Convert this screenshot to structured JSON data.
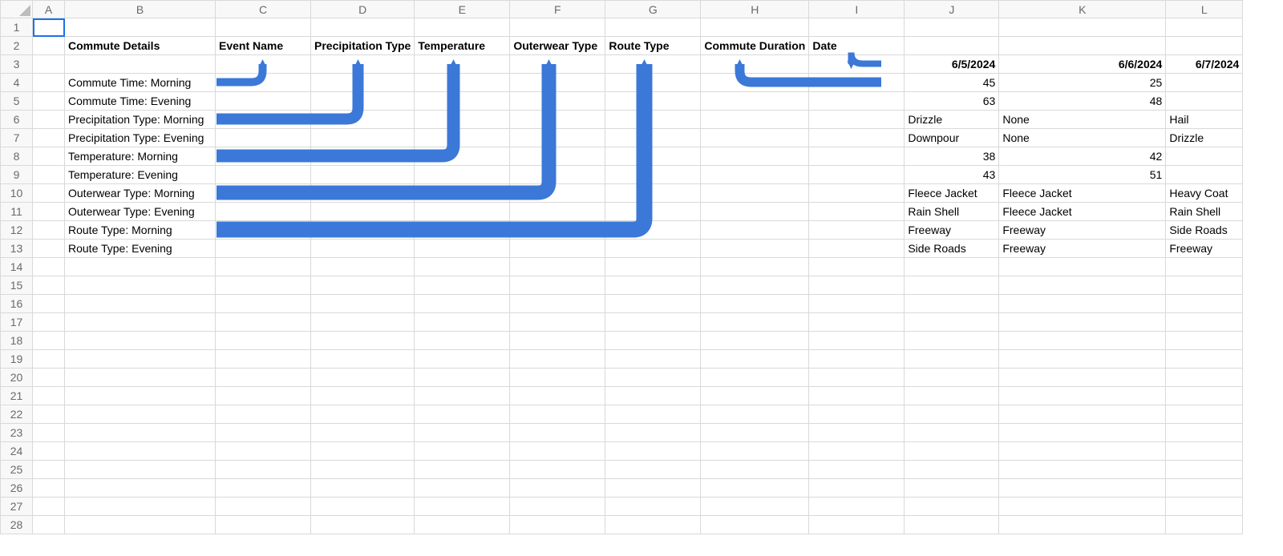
{
  "columns": [
    "A",
    "B",
    "C",
    "D",
    "E",
    "F",
    "G",
    "H",
    "I",
    "J",
    "K",
    "L"
  ],
  "row_count": 28,
  "selected_cell": "A1",
  "header_row": {
    "B": "Commute Details",
    "C": "Event Name",
    "D": "Precipitation Type",
    "E": "Temperature",
    "F": "Outerwear Type",
    "G": "Route Type",
    "H": "Commute Duration",
    "I": "Date"
  },
  "date_row": {
    "J": "6/5/2024",
    "K": "6/6/2024",
    "L": "6/7/2024"
  },
  "rows": [
    {
      "label": "Commute Time: Morning",
      "J": "45",
      "K": "25",
      "L": ""
    },
    {
      "label": "Commute Time: Evening",
      "J": "63",
      "K": "48",
      "L": ""
    },
    {
      "label": "Precipitation Type: Morning",
      "J": "Drizzle",
      "K": "None",
      "L": "Hail"
    },
    {
      "label": "Precipitation Type: Evening",
      "J": "Downpour",
      "K": "None",
      "L": "Drizzle"
    },
    {
      "label": "Temperature: Morning",
      "J": "38",
      "K": "42",
      "L": ""
    },
    {
      "label": "Temperature: Evening",
      "J": "43",
      "K": "51",
      "L": ""
    },
    {
      "label": "Outerwear Type: Morning",
      "J": "Fleece Jacket",
      "K": "Fleece Jacket",
      "L": "Heavy Coat"
    },
    {
      "label": "Outerwear Type: Evening",
      "J": "Rain Shell",
      "K": "Fleece Jacket",
      "L": "Rain Shell"
    },
    {
      "label": "Route Type: Morning",
      "J": "Freeway",
      "K": "Freeway",
      "L": "Side Roads"
    },
    {
      "label": "Route Type: Evening",
      "J": "Side Roads",
      "K": "Freeway",
      "L": "Freeway"
    }
  ],
  "numeric_right_align_rows": [
    0,
    1,
    4,
    5
  ],
  "arrows": [
    {
      "from_row": 4,
      "to_col": "C"
    },
    {
      "from_row": 6,
      "to_col": "D"
    },
    {
      "from_row": 8,
      "to_col": "E"
    },
    {
      "from_row": 10,
      "to_col": "F"
    },
    {
      "from_row": 12,
      "to_col": "G"
    },
    {
      "from_row": 4,
      "to_col": "H",
      "source": "J-right"
    },
    {
      "from_row": 3,
      "to_col": "I",
      "source": "J-right-short"
    }
  ],
  "arrow_color": "#3b78d8"
}
